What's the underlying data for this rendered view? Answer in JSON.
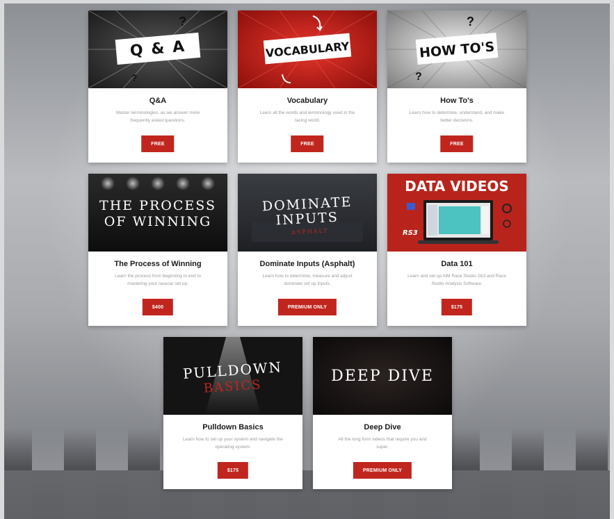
{
  "cards": [
    {
      "title": "Q&A",
      "desc": "Master terminologies, as we answer more frequently asked questions.",
      "button": "FREE",
      "thumb_text": "Q & A"
    },
    {
      "title": "Vocabulary",
      "desc": "Learn all the words and terminology used in the racing world.",
      "button": "FREE",
      "thumb_text": "VOCABULARY"
    },
    {
      "title": "How To's",
      "desc": "Learn how to determine, understand, and make better decisions.",
      "button": "FREE",
      "thumb_text": "HOW TO'S"
    },
    {
      "title": "The Process of Winning",
      "desc": "Learn the process from beginning to end to mastering your racecar set up.",
      "button": "$400",
      "thumb_line1": "THE PROCESS",
      "thumb_line2": "OF WINNING"
    },
    {
      "title": "Dominate Inputs (Asphalt)",
      "desc": "Learn how to determine, measure and adjust dominate set up inputs.",
      "button": "PREMIUM ONLY",
      "thumb_line1": "DOMINATE",
      "thumb_line2": "INPUTS",
      "thumb_line3": "ASPHALT"
    },
    {
      "title": "Data 101",
      "desc": "Learn and set up AiM Race Studio 2&3 and Race Studio Analysis Software.",
      "button": "$175",
      "thumb_text": "DATA VIDEOS",
      "thumb_logo": "RS3"
    },
    {
      "title": "Pulldown Basics",
      "desc": "Learn how to set up your system and navigate the operating system.",
      "button": "$175",
      "thumb_line1": "PULLDOWN",
      "thumb_line2": "BASICS"
    },
    {
      "title": "Deep Dive",
      "desc": "All the long form videos that require you and super.",
      "button": "PREMIUM ONLY",
      "thumb_text": "DEEP DIVE"
    }
  ],
  "colors": {
    "accent": "#c0261e",
    "card_bg": "#ffffff",
    "title": "#1a1a1a",
    "desc": "#9a9a9a"
  }
}
